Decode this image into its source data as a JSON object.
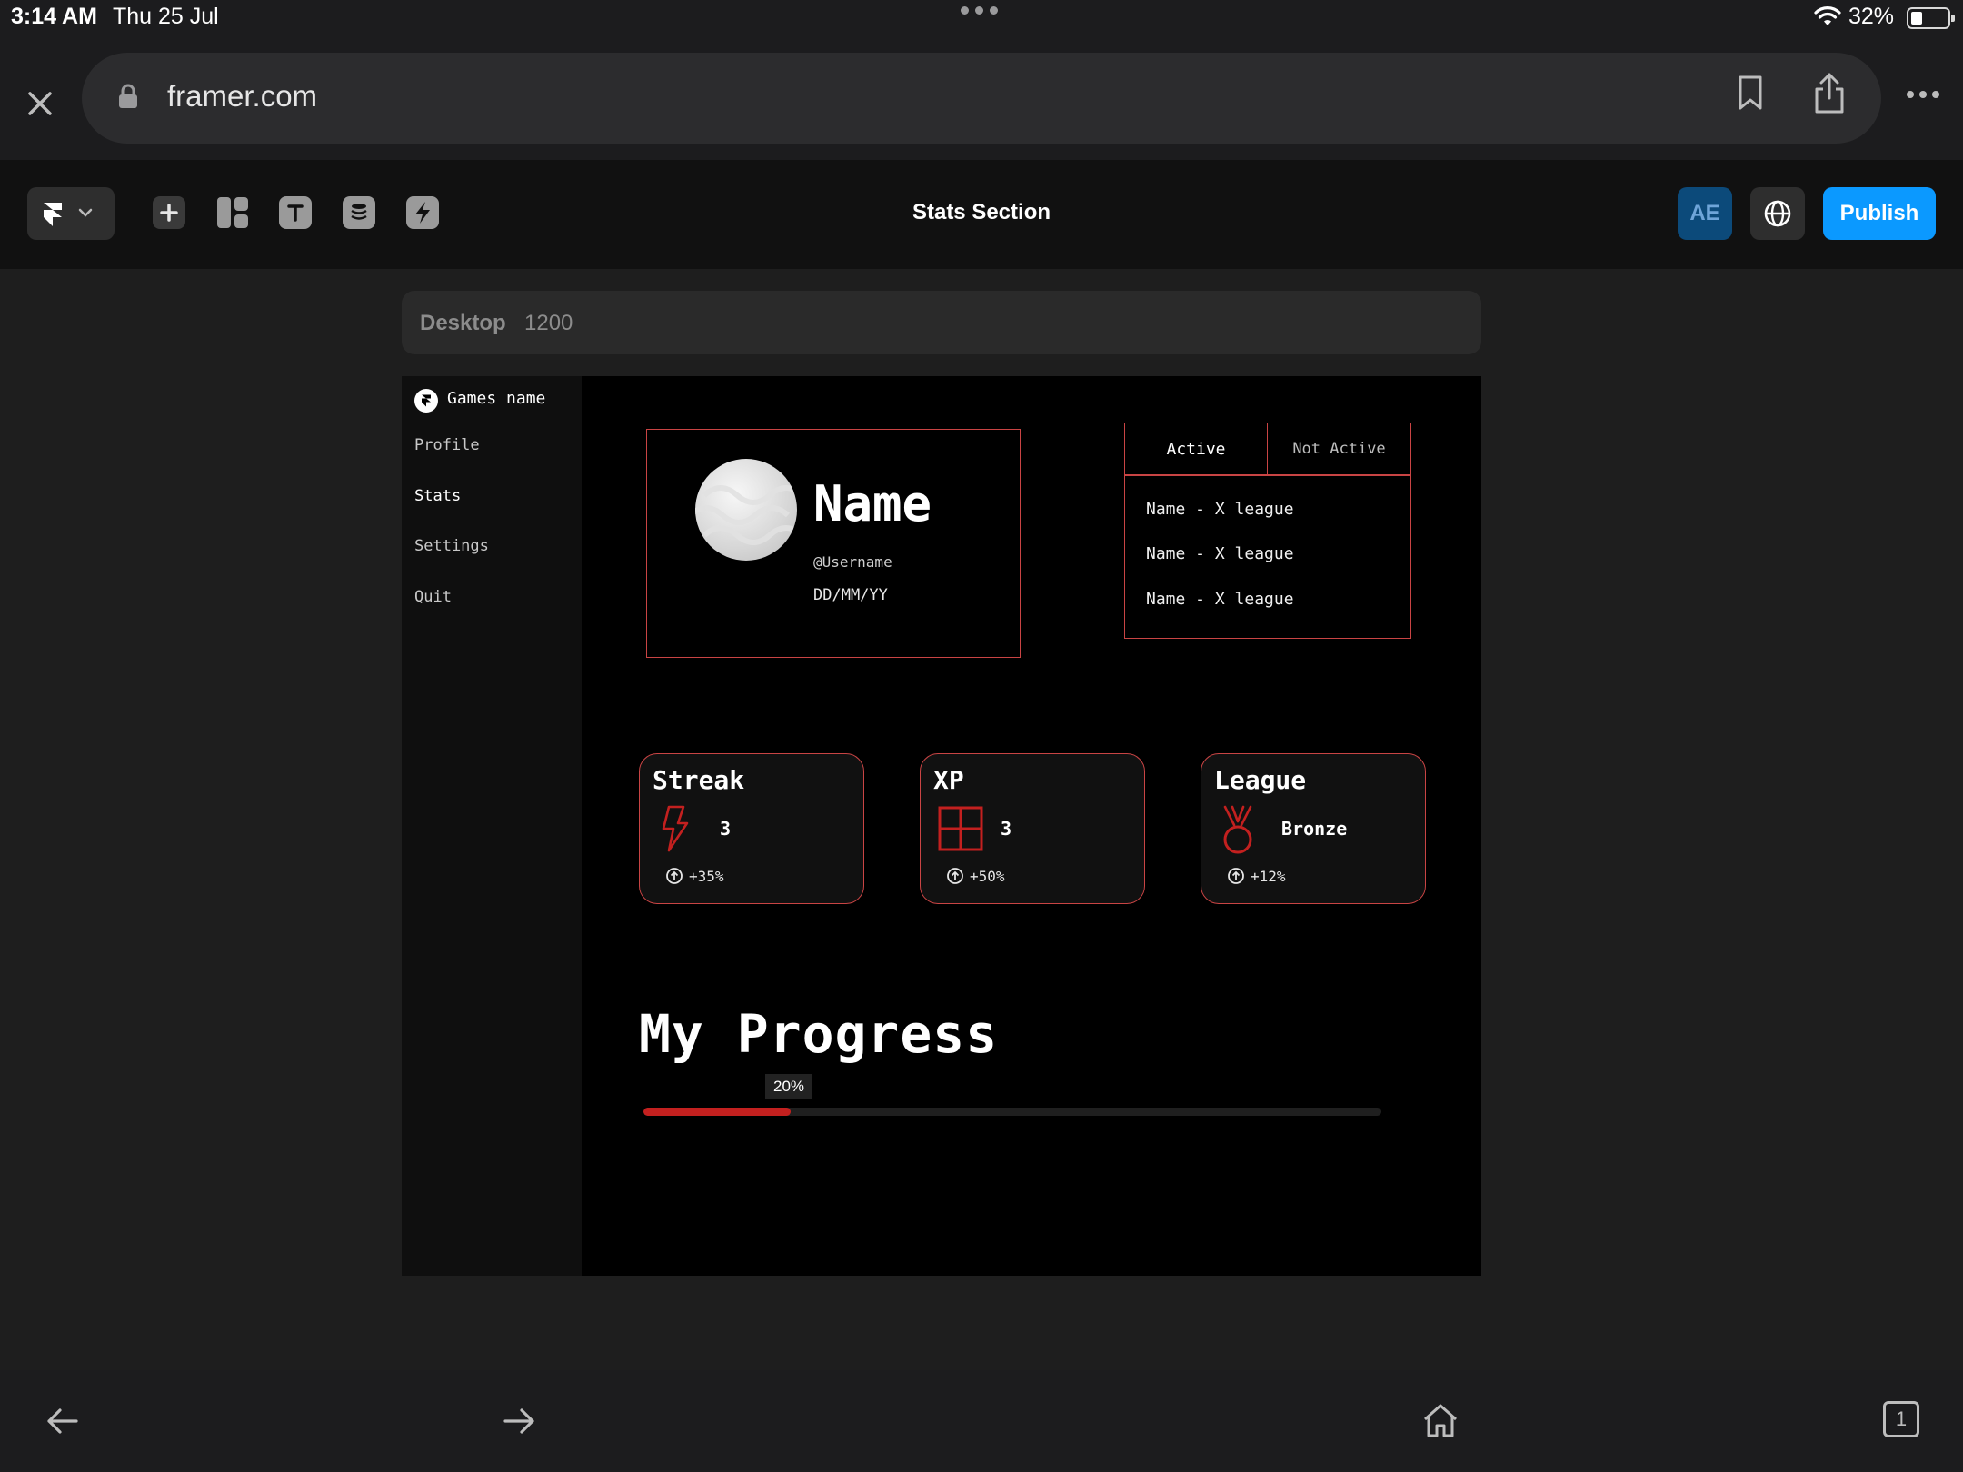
{
  "status": {
    "time": "3:14 AM",
    "date": "Thu 25 Jul",
    "battery": "32%"
  },
  "browser": {
    "url": "framer.com"
  },
  "toolbar": {
    "title": "Stats Section",
    "user_initials": "AE",
    "publish_label": "Publish"
  },
  "frame_label": {
    "name": "Desktop",
    "size": "1200"
  },
  "sidebar": {
    "brand": "Games name",
    "items": [
      {
        "label": "Profile"
      },
      {
        "label": "Stats"
      },
      {
        "label": "Settings"
      },
      {
        "label": "Quit"
      }
    ]
  },
  "profile": {
    "name": "Name",
    "username": "@Username",
    "date": "DD/MM/YY"
  },
  "league_panel": {
    "tabs": [
      "Active",
      "Not Active"
    ],
    "rows": [
      "Name - X league",
      "Name - X league",
      "Name - X league"
    ]
  },
  "stats": [
    {
      "title": "Streak",
      "value": "3",
      "delta": "+35%",
      "icon": "lightning-icon"
    },
    {
      "title": "XP",
      "value": "3",
      "delta": "+50%",
      "icon": "grid-icon"
    },
    {
      "title": "League",
      "value": "Bronze",
      "delta": "+12%",
      "icon": "medal-icon"
    }
  ],
  "progress": {
    "title": "My Progress",
    "percent_label": "20%",
    "value": 0.2
  },
  "colors": {
    "accent_red": "#c94444",
    "progress_red": "#c3201f",
    "publish_blue": "#0b99ff"
  },
  "bottom_bar": {
    "tab_count": "1"
  }
}
